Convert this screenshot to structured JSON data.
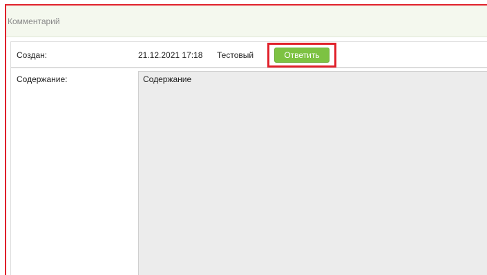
{
  "panel": {
    "title": "Комментарий"
  },
  "created": {
    "label": "Создан:",
    "datetime": "21.12.2021 17:18",
    "author": "Тестовый",
    "reply_label": "Ответить"
  },
  "content": {
    "label": "Содержание:",
    "value": "Содержание"
  },
  "colors": {
    "highlight": "#e0202a",
    "reply_button": "#7dc242",
    "header_bg": "#f4f8ee",
    "textarea_bg": "#ececec"
  }
}
